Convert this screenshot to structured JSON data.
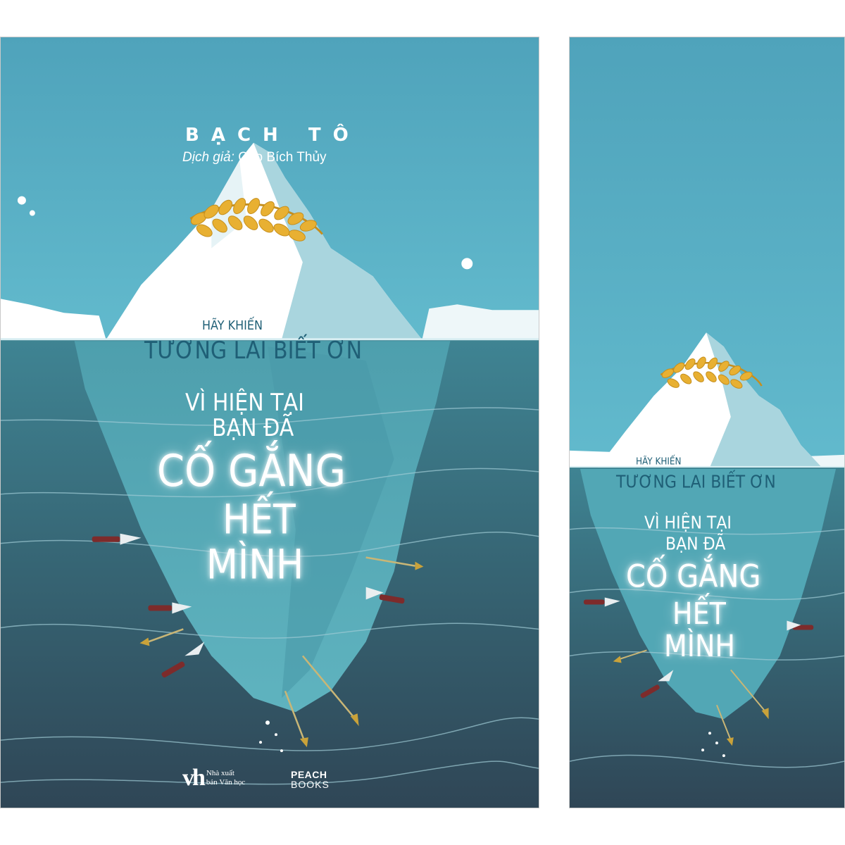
{
  "cover": {
    "author": "BẠCH TÔ",
    "translator_label": "Dịch giả:",
    "translator_name": "Cao Bích Thủy",
    "title_line1": "HÃY KHIẾN",
    "title_line2": "TƯƠNG LAI BIẾT ƠN",
    "title_line3": "VÌ HIỆN TẠI",
    "title_line4": "BẠN ĐÃ",
    "title_line5": "CỐ GẮNG",
    "title_line6": "HẾT",
    "title_line7": "MÌNH",
    "publisher_mark": "vh",
    "publisher_text": "Nhà xuất bản Văn học",
    "imprint_line1": "PEACH",
    "imprint_line2": "BOOKS"
  },
  "bookmark": {
    "title_line1": "HÃY KHIẾN",
    "title_line2": "TƯƠNG LAI BIẾT ƠN",
    "title_line3": "VÌ HIỆN TẠI",
    "title_line4": "BẠN ĐÃ",
    "title_line5": "CỐ GẮNG",
    "title_line6": "HẾT",
    "title_line7": "MÌNH"
  },
  "colors": {
    "sky_top": "#56a8bf",
    "sky_bottom": "#5fb8cc",
    "sea_top": "#3f8796",
    "sea_bottom": "#324d5e",
    "ice_light": "#ffffff",
    "ice_underwater": "#52a7b5",
    "wreath_gold": "#e8b032"
  },
  "icons": [
    "laurel-wreath",
    "arrow",
    "knife",
    "snowflake"
  ]
}
